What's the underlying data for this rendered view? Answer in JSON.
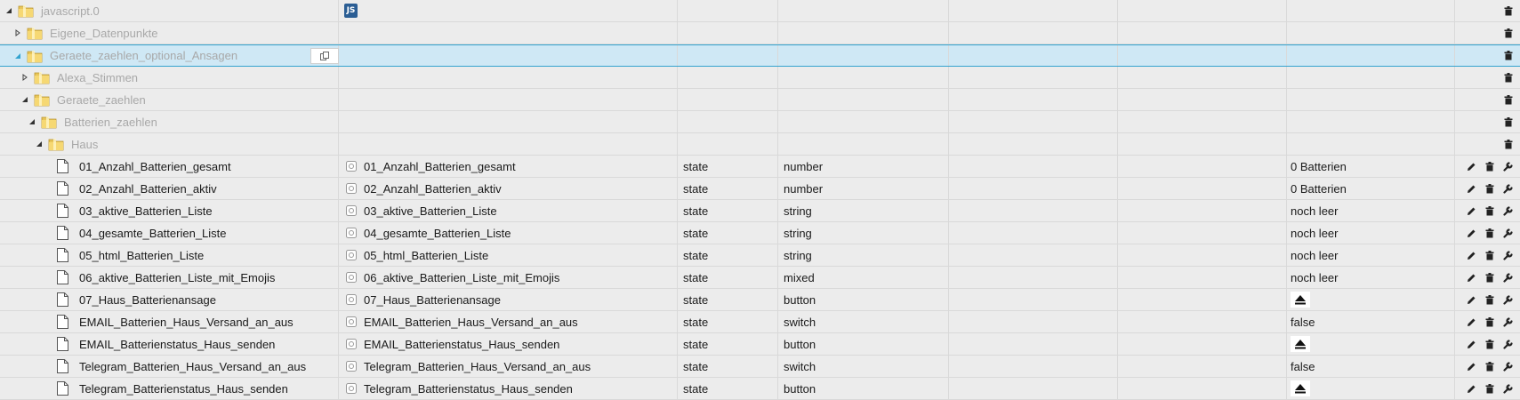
{
  "tree": {
    "root": {
      "label": "javascript.0",
      "badge": "JS"
    },
    "folders": [
      {
        "label": "Eigene_Datenpunkte"
      },
      {
        "label": "Geraete_zaehlen_optional_Ansagen"
      },
      {
        "label": "Alexa_Stimmen"
      },
      {
        "label": "Geraete_zaehlen"
      },
      {
        "label": "Batterien_zaehlen"
      },
      {
        "label": "Haus"
      }
    ],
    "states": [
      {
        "id": "01_Anzahl_Batterien_gesamt",
        "name": "01_Anzahl_Batterien_gesamt",
        "type": "state",
        "role": "number",
        "value": "0 Batterien"
      },
      {
        "id": "02_Anzahl_Batterien_aktiv",
        "name": "02_Anzahl_Batterien_aktiv",
        "type": "state",
        "role": "number",
        "value": "0 Batterien"
      },
      {
        "id": "03_aktive_Batterien_Liste",
        "name": "03_aktive_Batterien_Liste",
        "type": "state",
        "role": "string",
        "value": "noch leer"
      },
      {
        "id": "04_gesamte_Batterien_Liste",
        "name": "04_gesamte_Batterien_Liste",
        "type": "state",
        "role": "string",
        "value": "noch leer"
      },
      {
        "id": "05_html_Batterien_Liste",
        "name": "05_html_Batterien_Liste",
        "type": "state",
        "role": "string",
        "value": "noch leer"
      },
      {
        "id": "06_aktive_Batterien_Liste_mit_Emojis",
        "name": "06_aktive_Batterien_Liste_mit_Emojis",
        "type": "state",
        "role": "mixed",
        "value": "noch leer"
      },
      {
        "id": "07_Haus_Batterienansage",
        "name": "07_Haus_Batterienansage",
        "type": "state",
        "role": "button",
        "value": ""
      },
      {
        "id": "EMAIL_Batterien_Haus_Versand_an_aus",
        "name": "EMAIL_Batterien_Haus_Versand_an_aus",
        "type": "state",
        "role": "switch",
        "value": "false"
      },
      {
        "id": "EMAIL_Batterienstatus_Haus_senden",
        "name": "EMAIL_Batterienstatus_Haus_senden",
        "type": "state",
        "role": "button",
        "value": ""
      },
      {
        "id": "Telegram_Batterien_Haus_Versand_an_aus",
        "name": "Telegram_Batterien_Haus_Versand_an_aus",
        "type": "state",
        "role": "switch",
        "value": "false"
      },
      {
        "id": "Telegram_Batterienstatus_Haus_senden",
        "name": "Telegram_Batterienstatus_Haus_senden",
        "type": "state",
        "role": "button",
        "value": ""
      }
    ]
  },
  "icons": {
    "folder": "folder-icon",
    "state": "document-icon",
    "edit": "pencil-icon",
    "delete": "trash-icon",
    "settings": "wrench-icon",
    "copy": "copy-icon",
    "button_value": "eject-icon"
  },
  "colors": {
    "background": "#ececec",
    "selected_row": "#cfe8f5",
    "selected_border": "#34a3cf",
    "folder_label": "#a8a8a8",
    "js_badge": "#2b5e94"
  }
}
